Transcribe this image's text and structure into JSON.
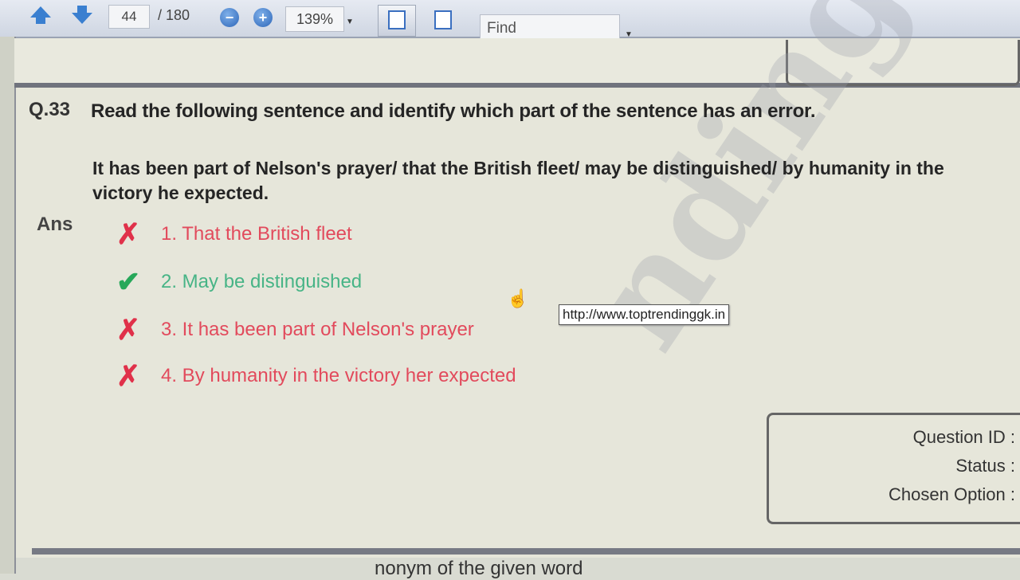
{
  "toolbar": {
    "current_page": "44",
    "total_pages": "/ 180",
    "zoom": "139%",
    "find_placeholder": "Find"
  },
  "question": {
    "number": "Q.33",
    "prompt": "Read the following sentence and identify which part of the sentence has an error.",
    "sentence": "It has been part of Nelson's prayer/ that the British fleet/ may be distinguished/ by humanity in the victory he expected."
  },
  "answer": {
    "label": "Ans",
    "options": [
      {
        "text": "1. That the British fleet",
        "status": "wrong"
      },
      {
        "text": "2. May be distinguished",
        "status": "correct"
      },
      {
        "text": "3. It has been part of Nelson's prayer",
        "status": "wrong"
      },
      {
        "text": "4. By humanity in the victory her expected",
        "status": "wrong"
      }
    ]
  },
  "tooltip": "http://www.toptrendinggk.in",
  "info_panel": {
    "question_id": "Question ID :",
    "status": "Status :",
    "chosen_option": "Chosen Option :"
  },
  "watermark": "ndinggk",
  "next_question_fragment": "nonym of the given word",
  "colors": {
    "wrong": "#e24a5c",
    "correct": "#47b486",
    "toolbar_accent": "#3a7fd0"
  }
}
